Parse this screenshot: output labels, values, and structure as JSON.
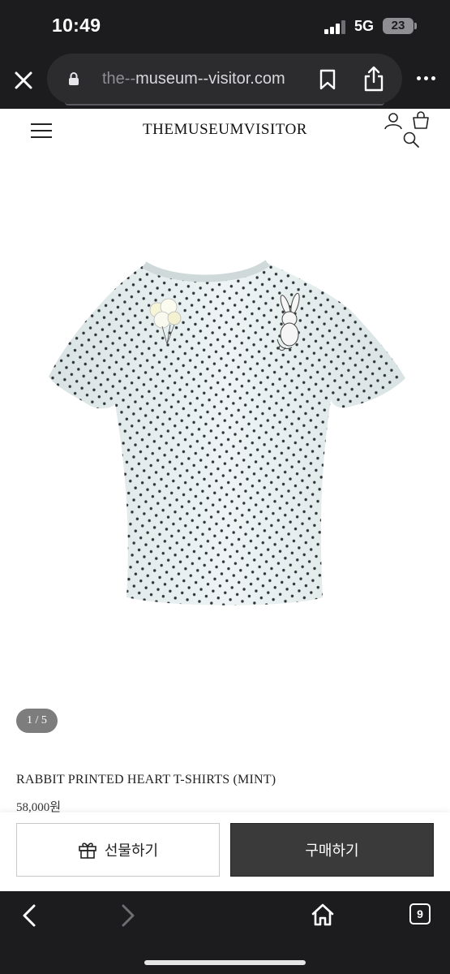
{
  "status_bar": {
    "time": "10:49",
    "network": "5G",
    "battery": "23"
  },
  "browser": {
    "url_prefix": "the--",
    "url_main": "museum--visitor.com",
    "tab_count": "9"
  },
  "site": {
    "logo": "THEMUSEUMVISITOR"
  },
  "product": {
    "image_icon": "polka-dot-mint-tshirt-with-rabbit-print",
    "slide_counter": "1 / 5",
    "name": "RABBIT PRINTED HEART T-SHIRTS (MINT)",
    "price": "58,000원"
  },
  "actions": {
    "gift_label": "선물하기",
    "buy_label": "구매하기"
  },
  "colors": {
    "browser_chrome": "#1c1c1e",
    "shirt": "#e6efef",
    "buy_button": "#3a3a3a"
  }
}
